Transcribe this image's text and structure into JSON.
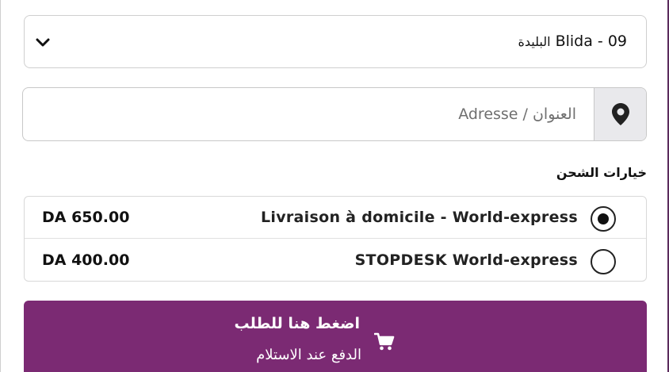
{
  "wilaya_select": {
    "value_code": "09",
    "value_name_fr": "Blida",
    "value_name_ar": "البليدة"
  },
  "address": {
    "placeholder": "العنوان / Adresse",
    "value": ""
  },
  "icons": {
    "select_chevron": "chevron-down-icon",
    "address": "map-marker-icon",
    "order": "cart-icon"
  },
  "shipping": {
    "title": "خيارات الشحن",
    "options": [
      {
        "name": "Livraison à domicile - World-express",
        "price": "DA 650.00",
        "selected": true
      },
      {
        "name": "STOPDESK World-express",
        "price": "DA 400.00",
        "selected": false
      }
    ]
  },
  "order_button": {
    "title": "اضغط هنا للطلب",
    "subtitle": "الدفع عند الاستلام"
  },
  "colors": {
    "accent": "#7b2a73",
    "border": "#cfcfcf",
    "icon_box_bg": "#e9e9ec",
    "text": "#111111"
  }
}
